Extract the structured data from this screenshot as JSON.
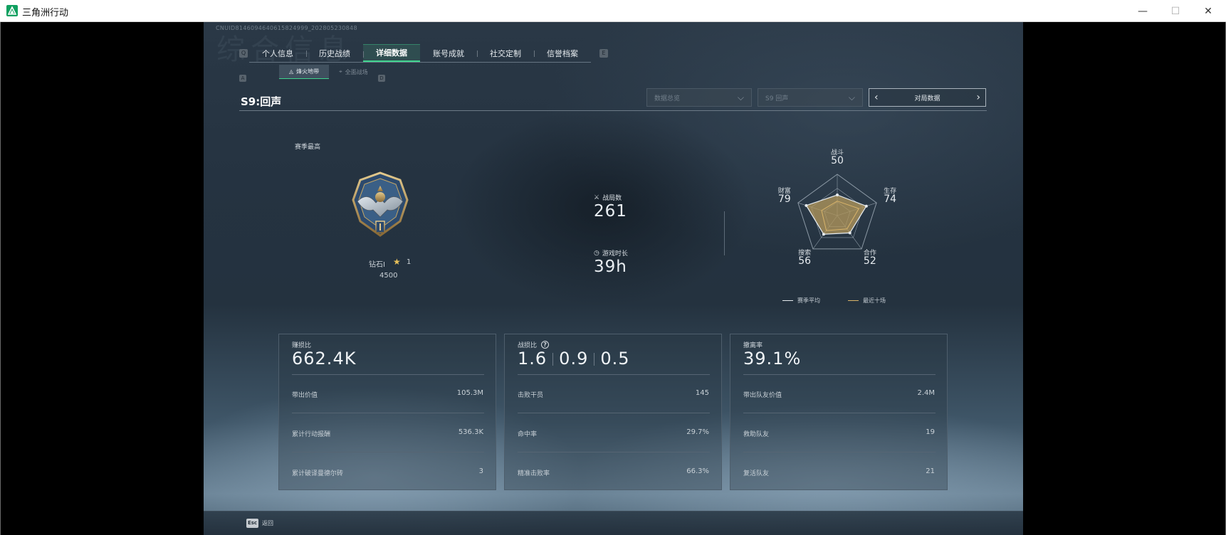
{
  "window": {
    "title": "三角洲行动",
    "minimize": "—",
    "maximize": "☐",
    "close": "✕"
  },
  "uid": "CNUID8146094640615824999_202805230848",
  "watermark": "综合信息",
  "tabs": {
    "key_left": "Q",
    "key_right": "E",
    "items": [
      {
        "label": "个人信息"
      },
      {
        "label": "历史战绩"
      },
      {
        "label": "详细数据",
        "active": true
      },
      {
        "label": "账号成就"
      },
      {
        "label": "社交定制"
      },
      {
        "label": "信誉档案"
      }
    ]
  },
  "subtabs": {
    "key_left": "A",
    "key_right": "D",
    "items": [
      {
        "label": "烽火地带",
        "active": true
      },
      {
        "label": "全面战场"
      }
    ]
  },
  "season": {
    "title": "S9:回声",
    "filter_mode": "数据总览",
    "filter_season": "S9 回声",
    "period_label": "对局数据"
  },
  "rank": {
    "season_best_label": "赛季最高",
    "name": "钻石I",
    "stars": "1",
    "score": "4500"
  },
  "stats": {
    "matches_label": "战局数",
    "matches_value": "261",
    "playtime_label": "游戏时长",
    "playtime_value": "39h"
  },
  "radar": {
    "axes": [
      {
        "label": "战斗",
        "value": 50
      },
      {
        "label": "生存",
        "value": 74
      },
      {
        "label": "合作",
        "value": 52
      },
      {
        "label": "搜索",
        "value": 56
      },
      {
        "label": "财富",
        "value": 79
      }
    ],
    "recent_values": [
      35,
      55,
      40,
      45,
      40
    ],
    "legend_season": "赛季平均",
    "legend_recent": "最近十场",
    "colors": {
      "season": "#e6ebef",
      "recent": "#d9b46a",
      "fill": "#b59a5c"
    }
  },
  "cards": [
    {
      "label": "赚损比",
      "big": "662.4K",
      "rows": [
        {
          "label": "带出价值",
          "value": "105.3M"
        },
        {
          "label": "累计行动报酬",
          "value": "536.3K"
        },
        {
          "label": "累计破译曼德尔砖",
          "value": "3"
        }
      ]
    },
    {
      "label": "战损比",
      "help": "?",
      "big_values": [
        "1.6",
        "0.9",
        "0.5"
      ],
      "rows": [
        {
          "label": "击败干员",
          "value": "145"
        },
        {
          "label": "命中率",
          "value": "29.7%"
        },
        {
          "label": "精准击败率",
          "value": "66.3%"
        }
      ]
    },
    {
      "label": "撤离率",
      "big": "39.1%",
      "rows": [
        {
          "label": "带出队友价值",
          "value": "2.4M"
        },
        {
          "label": "救助队友",
          "value": "19"
        },
        {
          "label": "复活队友",
          "value": "21"
        }
      ]
    }
  ],
  "bottom": {
    "esc_key": "Esc",
    "back_label": "返回"
  }
}
